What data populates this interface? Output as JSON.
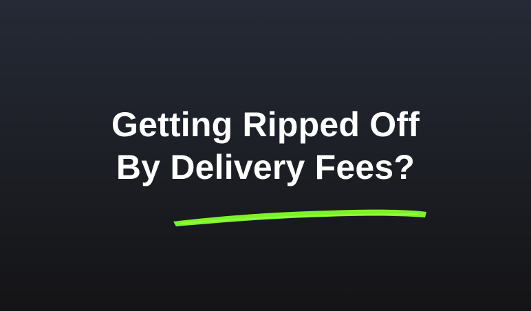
{
  "headline": {
    "line1": "Getting Ripped Off",
    "line2": "By Delivery Fees?"
  },
  "colors": {
    "background_top": "#252a36",
    "background_bottom": "#141416",
    "text": "#ffffff",
    "underline_accent": "#7df22a"
  },
  "icons": {
    "underline": "brush-stroke-underline"
  }
}
